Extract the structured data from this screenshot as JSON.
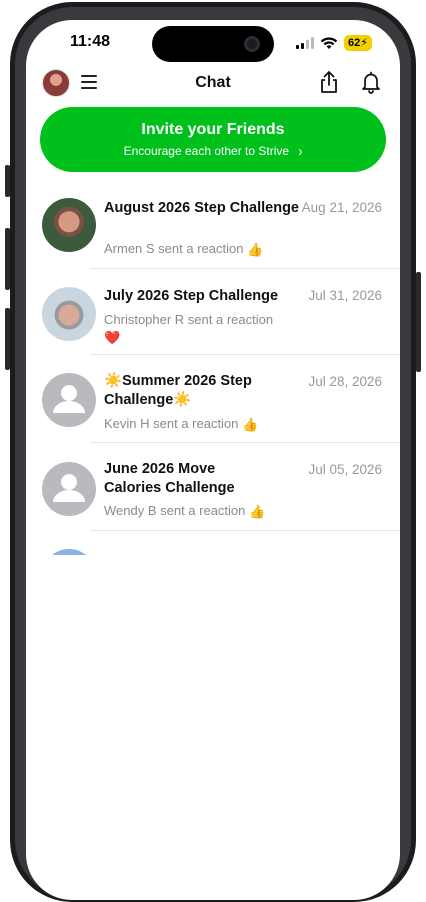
{
  "status_bar": {
    "time": "11:48",
    "battery": "62"
  },
  "header": {
    "title": "Chat"
  },
  "invite": {
    "title": "Invite your Friends",
    "subtitle": "Encourage each other to Strive",
    "chevron": ">"
  },
  "chats": [
    {
      "title": "August 2026 Step Challenge",
      "date": "Aug 21, 2026",
      "last": "Armen S sent a reaction",
      "emoji": "👍",
      "avatar": "photo"
    },
    {
      "title": "July 2026 Step Challenge",
      "date": "Jul 31, 2026",
      "last": "Christopher R sent a reaction",
      "emoji": "❤️",
      "avatar": "photo"
    },
    {
      "title_prefix": "☀️",
      "title": "Summer 2026 Step Challenge",
      "title_suffix": "☀️",
      "date": "Jul 28, 2026",
      "last": "Kevin H sent a reaction",
      "emoji": "👍",
      "avatar": "placeholder"
    },
    {
      "title": "June 2026 Move Calories Challenge",
      "date": "Jul 05, 2026",
      "last": "Wendy B sent a reaction",
      "emoji": "👍",
      "avatar": "placeholder"
    }
  ],
  "colors": {
    "accent_green": "#00c01c",
    "battery_yellow": "#f5d000"
  }
}
